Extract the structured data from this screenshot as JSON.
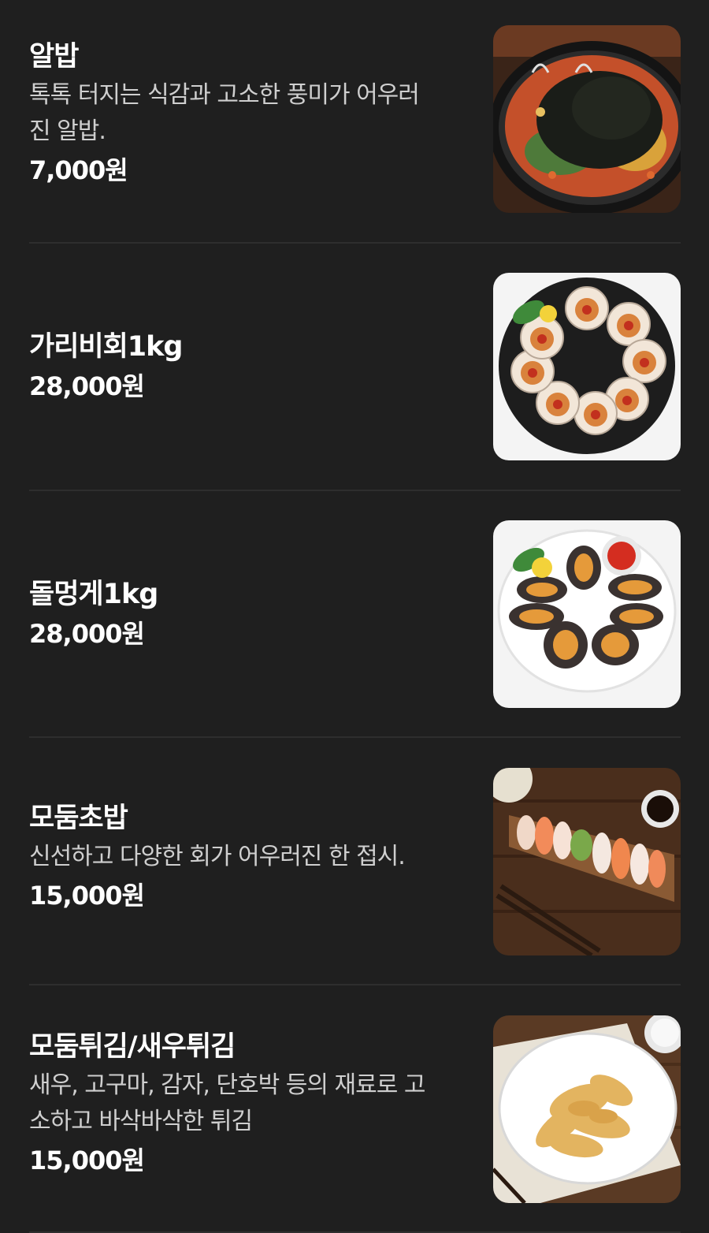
{
  "menu": {
    "items": [
      {
        "name": "알밥",
        "description_lines": [
          "톡톡 터지는 식감과 고소한 풍미가 어우러",
          "진 알밥."
        ],
        "price": "7,000원",
        "image": "rice-bowl-image"
      },
      {
        "name": "가리비회1kg",
        "description_lines": [],
        "price": "28,000원",
        "image": "scallop-platter-image"
      },
      {
        "name": "돌멍게1kg",
        "description_lines": [],
        "price": "28,000원",
        "image": "sea-squirt-platter-image"
      },
      {
        "name": "모둠초밥",
        "description_lines": [
          "신선하고 다양한 회가 어우러진 한 접시."
        ],
        "price": "15,000원",
        "image": "sushi-board-image"
      },
      {
        "name": "모둠튀김/새우튀김",
        "description_lines": [
          "새우, 고구마, 감자, 단호박 등의 재료로 고",
          "소하고 바삭바삭한 튀김"
        ],
        "price": "15,000원",
        "image": "tempura-plate-image"
      }
    ]
  },
  "colors": {
    "background": "#1f1f1f",
    "text_primary": "#ffffff",
    "text_secondary": "#cfcfcf",
    "divider": "#2e2e2e"
  }
}
